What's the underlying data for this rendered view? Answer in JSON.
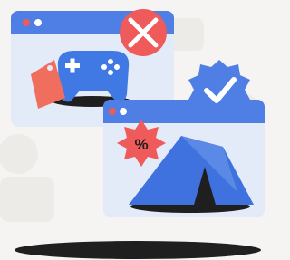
{
  "illustration": {
    "back_window": {
      "icon": "gamepad-icon",
      "tag_icon": "price-tag-icon",
      "badge_icon": "x-mark-icon"
    },
    "front_window": {
      "icon": "tent-icon",
      "discount_badge_text": "%",
      "badge_icon": "check-mark-icon"
    },
    "colors": {
      "background": "#f5f4f2",
      "window_body": "#e4ebf8",
      "title_bar": "#4f7fe4",
      "blue": "#3f72de",
      "red_accent": "#ef5a5a",
      "coral_tag": "#f06e5e",
      "dark": "#1f1f1f"
    }
  }
}
